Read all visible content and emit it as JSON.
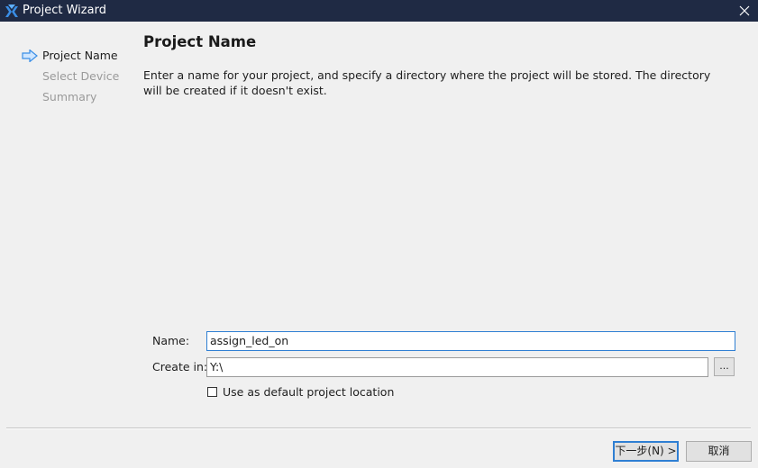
{
  "window": {
    "title": "Project Wizard"
  },
  "steps": [
    {
      "label": "Project Name",
      "active": true
    },
    {
      "label": "Select Device",
      "active": false
    },
    {
      "label": "Summary",
      "active": false
    }
  ],
  "page": {
    "title": "Project Name",
    "description": "Enter a name for your project, and specify a directory where the project will be stored. The directory will be created if it doesn't exist."
  },
  "form": {
    "name_label": "Name:",
    "name_value": "assign_led_on",
    "create_in_label": "Create in:",
    "create_in_value": "Y:\\",
    "browse_label": "...",
    "default_location_label": "Use as default project location",
    "default_location_checked": false
  },
  "buttons": {
    "next": "下一步(N) >",
    "cancel": "取消"
  },
  "colors": {
    "titlebar": "#1f2a44",
    "accent": "#2f7fd3",
    "step_arrow": "#3a8ee6"
  }
}
